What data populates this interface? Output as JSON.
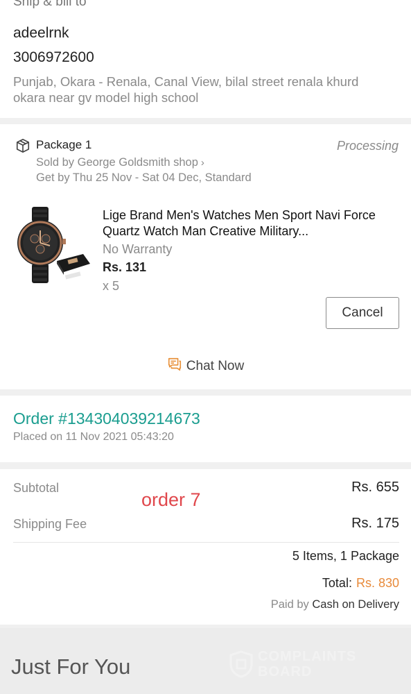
{
  "ship_bill": {
    "header": "Ship & bill to",
    "name": "adeelrnk",
    "phone": "3006972600",
    "address": "Punjab, Okara - Renala, Canal View, bilal street renala khurd okara near gv model high school"
  },
  "package": {
    "title": "Package 1",
    "status": "Processing",
    "seller": "Sold by George Goldsmith shop",
    "delivery": "Get by Thu 25 Nov - Sat 04 Dec, Standard",
    "icon": "package-box-icon",
    "product": {
      "title": "Lige Brand Men's Watches Men Sport Navi Force Quartz Watch Man Creative Military...",
      "warranty": "No Warranty",
      "price": "Rs. 131",
      "quantity": "x 5"
    },
    "cancel_label": "Cancel",
    "chat_label": "Chat Now",
    "chat_icon": "chat-icon"
  },
  "order": {
    "number": "Order #134304039214673",
    "placed": "Placed on 11 Nov 2021  05:43:20"
  },
  "totals": {
    "subtotal_label": "Subtotal",
    "subtotal_value": "Rs. 655",
    "annotation": "order 7",
    "shipping_label": "Shipping Fee",
    "shipping_value": "Rs. 175",
    "items_summary": "5 Items, 1 Package",
    "total_label": "Total:",
    "total_value": "Rs. 830",
    "paid_prefix": "Paid by",
    "paid_method": "Cash on Delivery"
  },
  "just_for_you": {
    "title": "Just For You"
  },
  "watermark": {
    "line1": "COMPLAINTS",
    "line2": "BOARD"
  },
  "colors": {
    "order_accent": "#1a9d8f",
    "total_accent": "#e88a3a",
    "annotation": "#e0474c",
    "chat_icon": "#e8913a"
  }
}
